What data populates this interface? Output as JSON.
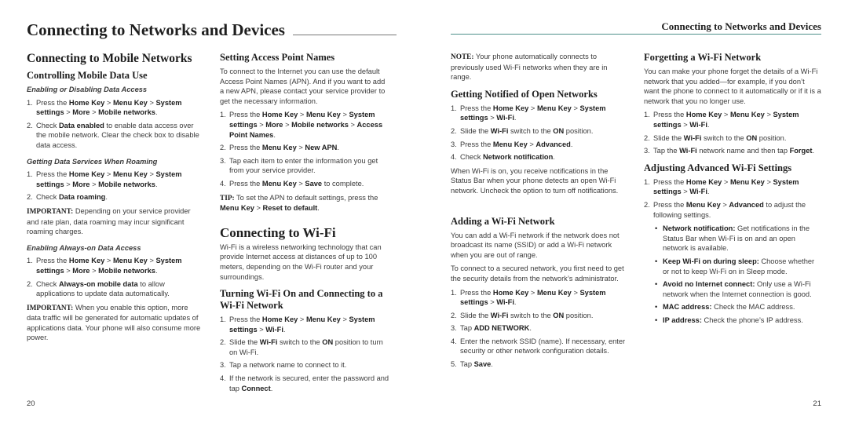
{
  "header": {
    "left_title": "Connecting to Networks and Devices",
    "right_title": "Connecting to Networks and Devices",
    "accent_color": "#4c8f8a"
  },
  "page_numbers": {
    "left": "20",
    "right": "21"
  },
  "col1": {
    "h1": "Connecting to Mobile Networks",
    "h2": "Controlling Mobile Data Use",
    "s1_title": "Enabling or Disabling Data Access",
    "s1_steps": [
      [
        "1.",
        "Press the ",
        "Home Key",
        " > ",
        "Menu Key",
        " > ",
        "System settings",
        " > ",
        "More",
        " > ",
        "Mobile networks",
        "."
      ],
      [
        "2.",
        "Check ",
        "Data enabled",
        " to enable data access over the mobile network. Clear the check box to disable data access."
      ]
    ],
    "s2_title": "Getting Data Services When Roaming",
    "s2_steps": [
      [
        "1.",
        "Press the ",
        "Home Key",
        " > ",
        "Menu Key",
        " > ",
        "System settings",
        " > ",
        "More",
        " > ",
        "Mobile networks",
        "."
      ],
      [
        "2.",
        "Check ",
        "Data roaming",
        "."
      ]
    ],
    "important1_label": "IMPORTANT:",
    "important1_text": " Depending on your service provider and rate plan, data roaming may incur significant roaming charges.",
    "s3_title": "Enabling Always-on Data Access",
    "s3_steps": [
      [
        "1.",
        "Press the ",
        "Home Key",
        " > ",
        "Menu Key",
        " > ",
        "System settings",
        " > ",
        "More",
        " > ",
        "Mobile networks",
        "."
      ],
      [
        "2.",
        "Check ",
        "Always-on mobile data",
        " to allow applications to update data automatically."
      ]
    ],
    "important2_label": "IMPORTANT:",
    "important2_text": " When you enable this option, more data traffic will be generated for automatic updates of applications data. Your phone will also consume more power."
  },
  "col2": {
    "apn_title": "Setting Access Point Names",
    "apn_intro": "To connect to the Internet you can use the default Access Point Names (APN). And if you want to add a new APN, please contact your service provider to get the necessary information.",
    "apn_steps": [
      [
        "1.",
        "Press the ",
        "Home Key",
        " > ",
        "Menu Key",
        " > ",
        "System settings",
        " > ",
        "More",
        " > ",
        "Mobile networks",
        " > ",
        "Access Point Names",
        "."
      ],
      [
        "2.",
        "Press the ",
        "Menu Key",
        " > ",
        "New APN",
        "."
      ],
      [
        "3.",
        "Tap each item to enter the information you get from your service provider."
      ],
      [
        "4.",
        "Press the ",
        "Menu Key",
        " > ",
        "Save",
        " to complete."
      ]
    ],
    "tip_label": "TIP:",
    "tip_text": " To set the APN to default settings, press the ",
    "tip_key1": "Menu Key",
    "tip_sep": " > ",
    "tip_key2": "Reset to default",
    "tip_end": ".",
    "wifi_title": "Connecting to Wi-Fi",
    "wifi_intro": "Wi-Fi is a wireless networking technology that can provide Internet access at distances of up to 100 meters, depending on the Wi-Fi router and your surroundings.",
    "turn_title": "Turning Wi-Fi On and Connecting to a Wi-Fi Network",
    "turn_steps": [
      [
        "1.",
        "Press the ",
        "Home Key",
        " > ",
        "Menu Key",
        " > ",
        "System settings",
        " > ",
        "Wi-Fi",
        "."
      ],
      [
        "2.",
        "Slide the ",
        "Wi-Fi",
        " switch to the ",
        "ON",
        " position to turn on Wi-Fi."
      ],
      [
        "3.",
        "Tap a network name to connect to it."
      ],
      [
        "4.",
        "If the network is secured, enter the password and tap ",
        "Connect",
        "."
      ]
    ]
  },
  "col3": {
    "note_label": "NOTE:",
    "note_text": " Your phone automatically connects to previously used Wi-Fi networks when they are in range.",
    "notify_title": "Getting Notified of Open Networks",
    "notify_steps": [
      [
        "1.",
        "Press the ",
        "Home Key",
        " > ",
        "Menu Key",
        " > ",
        "System settings",
        " > ",
        "Wi-Fi",
        "."
      ],
      [
        "2.",
        "Slide the ",
        "Wi-Fi",
        " switch to the ",
        "ON",
        " position."
      ],
      [
        "3.",
        "Press the ",
        "Menu Key",
        " > ",
        "Advanced",
        "."
      ],
      [
        "4.",
        "Check ",
        "Network notification",
        "."
      ]
    ],
    "notify_text": "When Wi-Fi is on, you receive notifications in the Status Bar when your phone detects an open Wi-Fi network. Uncheck the option to turn off notifications.",
    "add_title": "Adding a Wi-Fi Network",
    "add_intro1": "You can add a Wi-Fi network if the network does not broadcast its name (SSID) or add a Wi-Fi network when you are out of range.",
    "add_intro2": "To connect to a secured network, you first need to get the security details from the network’s administrator.",
    "add_steps": [
      [
        "1.",
        "Press the ",
        "Home Key",
        " > ",
        "Menu Key",
        " > ",
        "System settings",
        " > ",
        "Wi-Fi",
        "."
      ],
      [
        "2.",
        "Slide the ",
        "Wi-Fi",
        " switch to the ",
        "ON",
        " position."
      ],
      [
        "3.",
        "Tap ",
        "ADD NETWORK",
        "."
      ],
      [
        "4.",
        "Enter the network SSID (name). If necessary, enter security or other network configuration details."
      ],
      [
        "5.",
        "Tap ",
        "Save",
        "."
      ]
    ]
  },
  "col4": {
    "forget_title": "Forgetting a Wi-Fi Network",
    "forget_intro": "You can make your phone forget the details of a Wi-Fi network that you added—for example, if you don’t want the phone to connect to it automatically or if it is a network that you no longer use.",
    "forget_steps": [
      [
        "1.",
        "Press the ",
        "Home Key",
        " > ",
        "Menu Key",
        " > ",
        "System settings",
        " > ",
        "Wi-Fi",
        "."
      ],
      [
        "2.",
        "Slide the ",
        "Wi-Fi",
        " switch to the ",
        "ON",
        " position."
      ],
      [
        "3.",
        "Tap the ",
        "Wi-Fi",
        " network name and then tap ",
        "Forget",
        "."
      ]
    ],
    "adv_title": "Adjusting Advanced Wi-Fi Settings",
    "adv_steps": [
      [
        "1.",
        "Press the ",
        "Home Key",
        " > ",
        "Menu Key",
        " > ",
        "System settings",
        " > ",
        "Wi-Fi",
        "."
      ],
      [
        "2.",
        "Press the ",
        "Menu Key",
        " > ",
        "Advanced",
        " to adjust the following settings."
      ]
    ],
    "adv_bullets": [
      [
        "Network notification:",
        " Get notifications in the Status Bar when Wi-Fi is on and an open network is available."
      ],
      [
        "Keep Wi-Fi on during sleep:",
        " Choose whether or not to keep Wi-Fi on in Sleep mode."
      ],
      [
        "Avoid no Internet connect:",
        " Only use a Wi-Fi network when the Internet connection is good."
      ],
      [
        "MAC address:",
        " Check the MAC address."
      ],
      [
        "IP address:",
        " Check the phone’s IP address."
      ]
    ]
  }
}
